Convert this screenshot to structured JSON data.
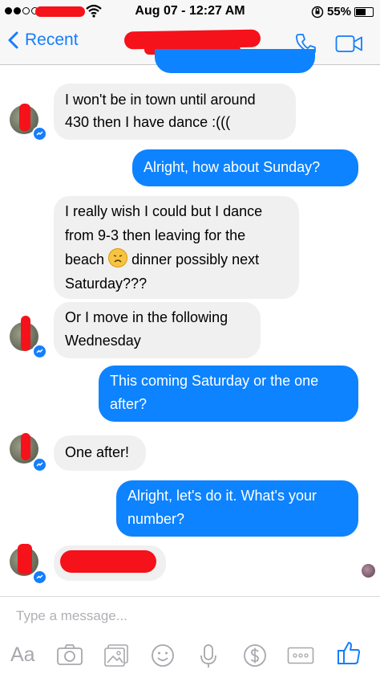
{
  "status_bar": {
    "time": "Aug 07 - 12:27 AM",
    "battery": "55%",
    "battery_level": 0.55
  },
  "nav": {
    "back_label": "Recent"
  },
  "messages": [
    {
      "direction": "in",
      "lines": [
        "I won't be in town until around",
        "430 then I have dance :((("
      ]
    },
    {
      "direction": "out",
      "lines": [
        "Alright, how about Sunday?"
      ]
    },
    {
      "direction": "in",
      "lines": [
        "I really wish I could but I dance",
        "from 9-3 then leaving for the",
        "dinner possibly next",
        "Saturday???"
      ],
      "inline_before": "beach",
      "emoji": "disappointed-face"
    },
    {
      "direction": "in",
      "lines": [
        "Or I move in the following",
        "Wednesday"
      ]
    },
    {
      "direction": "out",
      "lines": [
        "This coming Saturday or the one",
        "after?"
      ]
    },
    {
      "direction": "in",
      "lines": [
        "One after!"
      ]
    },
    {
      "direction": "out",
      "lines": [
        "Alright, let's do it. What's your",
        "number?"
      ]
    }
  ],
  "composer": {
    "placeholder": "Type a message...",
    "text_button": "Aa"
  },
  "colors": {
    "accent": "#157efb",
    "outgoing_bubble": "#0d83ff",
    "incoming_bubble": "#f0f0f0",
    "redaction": "#f5121a"
  }
}
